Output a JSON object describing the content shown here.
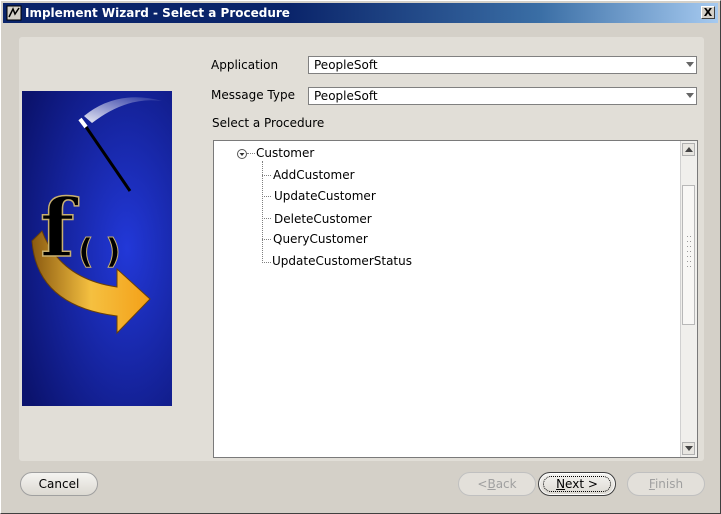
{
  "window": {
    "title": "Implement Wizard - Select a Procedure",
    "close_glyph": "X"
  },
  "form": {
    "application_label": "Application",
    "application_value": "PeopleSoft",
    "message_type_label": "Message Type",
    "message_type_value": "PeopleSoft",
    "procedure_label": "Select a Procedure"
  },
  "tree": {
    "root": "Customer",
    "children": [
      "AddCustomer",
      "UpdateCustomer",
      "DeleteCustomer",
      "QueryCustomer",
      "UpdateCustomerStatus"
    ]
  },
  "buttons": {
    "cancel": "Cancel",
    "back_arrow": "<",
    "back_mnemonic": "B",
    "back_rest": "ack",
    "next_mnemonic": "N",
    "next_rest": "ext",
    "next_arrow": ">",
    "finish_mnemonic": "F",
    "finish_rest": "inish"
  },
  "graphic": {
    "glyph_f": "f",
    "glyph_parens": "( )",
    "colors": {
      "background": "#1a2aa8",
      "arrow": "#f0a020"
    }
  },
  "icons": [
    "app-icon",
    "close-icon",
    "tree-expanded-icon",
    "scroll-up-icon",
    "scroll-down-icon",
    "wizard-graphic"
  ]
}
